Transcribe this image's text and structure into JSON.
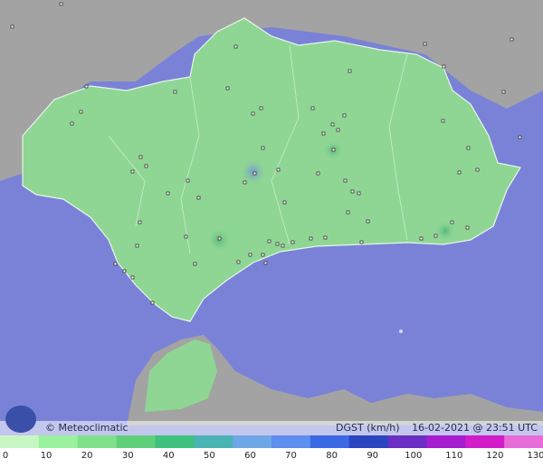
{
  "brand": {
    "name": "© Meteoclimatic",
    "logo_icon": "meteoclimatic-logo-icon"
  },
  "info": {
    "variable": "DGST (km/h)",
    "timestamp": "16-02-2021 @ 23:51 UTC"
  },
  "legend": {
    "ticks": [
      "0",
      "10",
      "20",
      "30",
      "40",
      "50",
      "60",
      "70",
      "80",
      "90",
      "100",
      "110",
      "120",
      "130"
    ],
    "colors": [
      "#c9f7c4",
      "#9af29c",
      "#7fe28a",
      "#5fd07a",
      "#3fc17e",
      "#4ab3b3",
      "#6fa7e6",
      "#5d8ef0",
      "#3b69e4",
      "#2b44c2",
      "#6a2ec4",
      "#a51cd1",
      "#d31cc9",
      "#e96bd8"
    ]
  },
  "map": {
    "sea_color": "#7a82d8",
    "land_color": "#8fd694",
    "neighbor_land_color": "#a3a3a3",
    "region": "Andalucía"
  }
}
